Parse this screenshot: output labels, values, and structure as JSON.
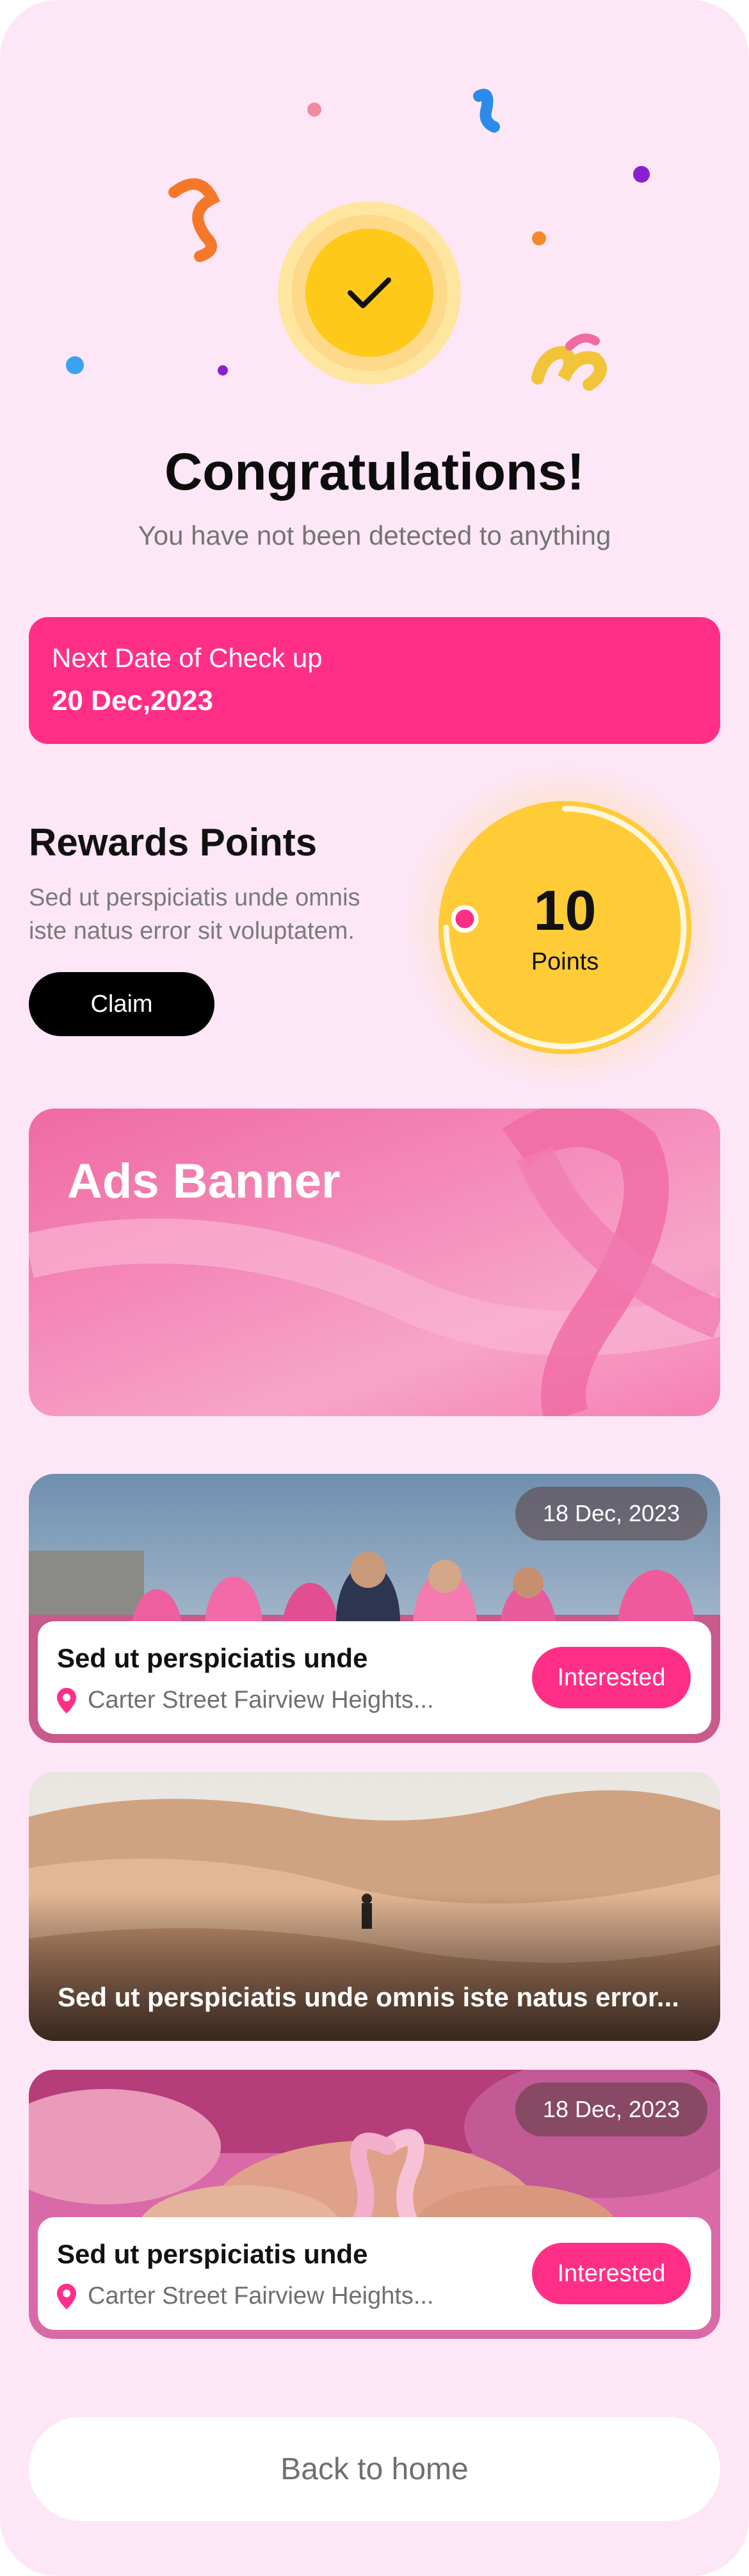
{
  "success": {
    "title": "Congratulations!",
    "subtitle": "You have not been detected to anything",
    "icon": "check-icon"
  },
  "checkup": {
    "label": "Next Date of Check up",
    "date": "20 Dec,2023"
  },
  "rewards": {
    "title": "Rewards Points",
    "description": "Sed ut perspiciatis unde omnis iste natus error sit voluptatem.",
    "claim_label": "Claim",
    "points_value": "10",
    "points_label": "Points"
  },
  "ads": {
    "title": "Ads Banner"
  },
  "events": [
    {
      "date": "18 Dec, 2023",
      "title": "Sed ut perspiciatis unde",
      "location": "Carter Street Fairview Heights...",
      "button": "Interested"
    },
    {
      "caption": "Sed ut perspiciatis unde omnis iste natus error..."
    },
    {
      "date": "18 Dec, 2023",
      "title": "Sed ut perspiciatis unde",
      "location": "Carter Street Fairview Heights...",
      "button": "Interested"
    }
  ],
  "footer": {
    "back_label": "Back to home"
  },
  "colors": {
    "background": "#fde7f6",
    "primary_pink": "#ff2f87",
    "yellow": "#ffcb37",
    "black": "#000000"
  }
}
